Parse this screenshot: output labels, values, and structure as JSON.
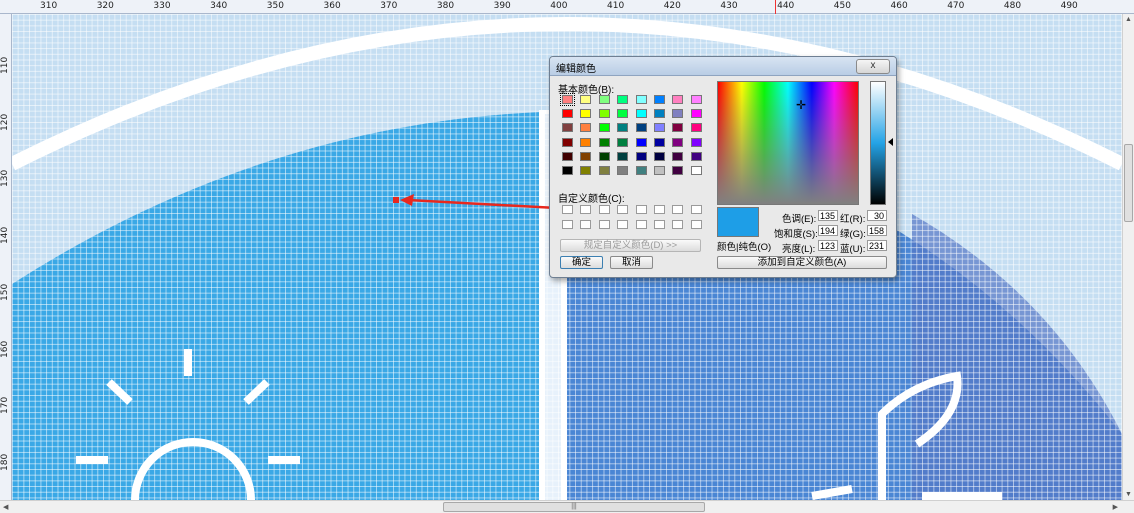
{
  "ruler": {
    "h_labels": [
      "310",
      "320",
      "330",
      "340",
      "350",
      "360",
      "370",
      "380",
      "390",
      "400",
      "410",
      "420",
      "430",
      "440",
      "450",
      "460",
      "470",
      "480",
      "490"
    ],
    "v_labels": [
      "110",
      "120",
      "130",
      "140",
      "150",
      "160",
      "170",
      "180"
    ]
  },
  "canvas": {
    "colors": {
      "background": "#c5def2",
      "arc": "#ffffff",
      "left_panel": "#3aa8e6",
      "right_panel": "#4a86d4",
      "right_panel_far": "#5577c6",
      "divider": "#ffffff"
    },
    "icons": [
      "sun-icon",
      "leaf-icon"
    ]
  },
  "dialog": {
    "title": "编辑颜色",
    "close_label": "x",
    "basic_colors_label": "基本颜色(B):",
    "custom_colors_label": "自定义颜色(C):",
    "define_custom_button": "规定自定义颜色(D) >>",
    "ok_button": "确定",
    "cancel_button": "取消",
    "color_solid_label": "颜色|纯色(O)",
    "add_custom_button": "添加到自定义颜色(A)",
    "hue_label": "色调(E):",
    "sat_label": "饱和度(S):",
    "lum_label": "亮度(L):",
    "red_label": "红(R):",
    "green_label": "绿(G):",
    "blue_label": "蓝(U):",
    "hue_value": "135",
    "sat_value": "194",
    "lum_value": "123",
    "red_value": "30",
    "green_value": "158",
    "blue_value": "231",
    "preview_color": "#1e9ee7",
    "basic_colors": [
      "#ff8080",
      "#ffff80",
      "#80ff80",
      "#00ff80",
      "#80ffff",
      "#0080ff",
      "#ff80c0",
      "#ff80ff",
      "#ff0000",
      "#ffff00",
      "#80ff00",
      "#00ff40",
      "#00ffff",
      "#0080c0",
      "#8080c0",
      "#ff00ff",
      "#804040",
      "#ff8040",
      "#00ff00",
      "#008080",
      "#004080",
      "#8080ff",
      "#800040",
      "#ff0080",
      "#800000",
      "#ff8000",
      "#008000",
      "#008040",
      "#0000ff",
      "#0000a0",
      "#800080",
      "#8000ff",
      "#400000",
      "#804000",
      "#004000",
      "#004040",
      "#000080",
      "#000040",
      "#400040",
      "#400080",
      "#000000",
      "#808000",
      "#808040",
      "#808080",
      "#408080",
      "#c0c0c0",
      "#400040",
      "#ffffff"
    ]
  },
  "pointer": {
    "color": "#e8281e"
  }
}
